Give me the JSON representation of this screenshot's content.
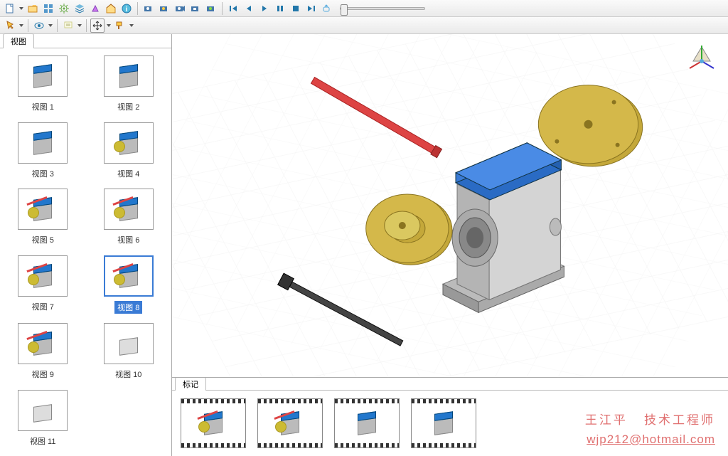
{
  "toolbar1": {
    "icons": [
      "new",
      "down",
      "open",
      "grid",
      "gear",
      "layers",
      "prism",
      "home",
      "info",
      "sep",
      "cam1",
      "cam2",
      "cam3",
      "cam4",
      "cam5",
      "sep",
      "first",
      "prev",
      "play",
      "pause",
      "stop",
      "last",
      "share"
    ]
  },
  "toolbar2": {
    "icons": [
      "pointer",
      "dd",
      "eye",
      "dd",
      "sep",
      "note",
      "dd",
      "sep",
      "move",
      "dd",
      "paint",
      "dd"
    ]
  },
  "sidebar": {
    "tab_label": "视图",
    "items": [
      {
        "label": "视图 1",
        "preset": "basic"
      },
      {
        "label": "视图 2",
        "preset": "basic"
      },
      {
        "label": "视图 3",
        "preset": "basic"
      },
      {
        "label": "视图 4",
        "preset": "disc"
      },
      {
        "label": "视图 5",
        "preset": "exploded"
      },
      {
        "label": "视图 6",
        "preset": "exploded"
      },
      {
        "label": "视图 7",
        "preset": "exploded"
      },
      {
        "label": "视图 8",
        "preset": "exploded",
        "selected": true
      },
      {
        "label": "视图 9",
        "preset": "exploded"
      },
      {
        "label": "视图 10",
        "preset": "frame"
      },
      {
        "label": "视图 11",
        "preset": "frame"
      }
    ]
  },
  "marks": {
    "tab_label": "标记",
    "frames": [
      {
        "preset": "exploded"
      },
      {
        "preset": "exploded"
      },
      {
        "preset": "basic"
      },
      {
        "preset": "basic"
      }
    ]
  },
  "watermark": {
    "name": "王江平",
    "title": "技术工程师",
    "email": "wjp212@hotmail.com"
  }
}
